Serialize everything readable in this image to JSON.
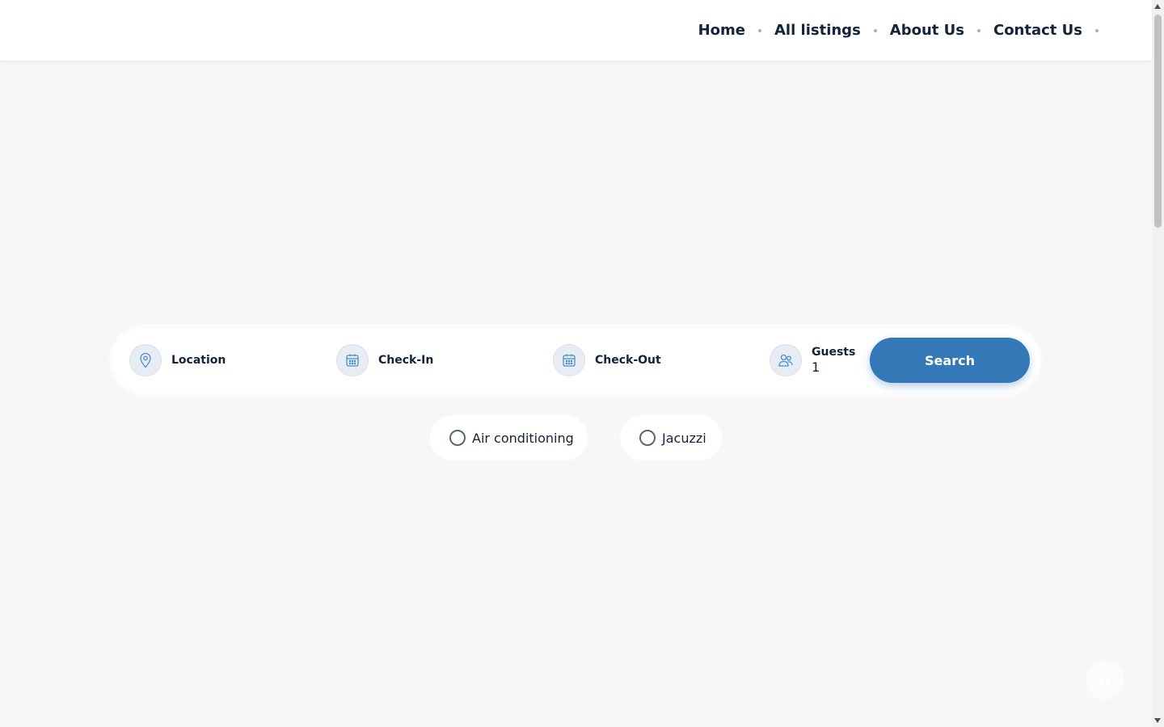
{
  "nav": {
    "items": [
      {
        "label": "Home"
      },
      {
        "label": "All listings"
      },
      {
        "label": "About Us"
      },
      {
        "label": "Contact Us"
      }
    ]
  },
  "search": {
    "location_label": "Location",
    "checkin_label": "Check-In",
    "checkout_label": "Check-Out",
    "guests_label": "Guests",
    "guests_value": "1",
    "button_label": "Search"
  },
  "amenities": [
    {
      "label": "Air conditioning",
      "checked": false
    },
    {
      "label": "Jacuzzi",
      "checked": false
    }
  ],
  "colors": {
    "accent": "#3578b8",
    "text": "#13233a",
    "background": "#f7f7f7",
    "icon_stroke": "#4a8fcf"
  },
  "icons": {
    "location": "map-pin-icon",
    "checkin": "calendar-icon",
    "checkout": "calendar-icon",
    "guests": "users-icon",
    "floating": "pause-icon"
  }
}
